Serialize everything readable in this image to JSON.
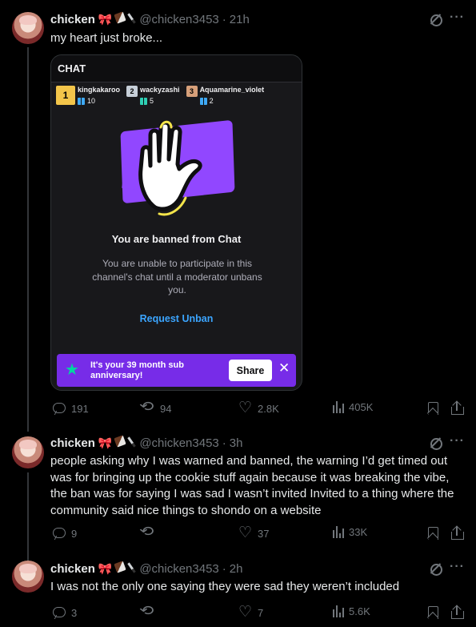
{
  "tweets": [
    {
      "name": "chicken",
      "handle": "@chicken3453",
      "time": "21h",
      "text": "my heart just broke...",
      "stats": {
        "replies": "191",
        "reposts": "94",
        "likes": "2.8K",
        "views": "405K"
      }
    },
    {
      "name": "chicken",
      "handle": "@chicken3453",
      "time": "3h",
      "text": "people asking why I was warned and banned, the warning I’d get timed out was for bringing up the cookie stuff again because it was breaking the vibe, the ban was for saying I was sad I wasn’t invited Invited to a thing where the community said nice things to shondo on a website",
      "stats": {
        "replies": "9",
        "reposts": "",
        "likes": "37",
        "views": "33K"
      }
    },
    {
      "name": "chicken",
      "handle": "@chicken3453",
      "time": "2h",
      "text": "I was not the only one saying they were sad they weren’t included",
      "stats": {
        "replies": "3",
        "reposts": "",
        "likes": "7",
        "views": "5.6K"
      }
    }
  ],
  "separator": "·",
  "more_glyph": "···",
  "media": {
    "header": "CHAT",
    "leaders": [
      {
        "rank": "1",
        "name": "kingkakaroo",
        "count": "10"
      },
      {
        "rank": "2",
        "name": "wackyzashi",
        "count": "5"
      },
      {
        "rank": "3",
        "name": "Aquamarine_violet",
        "count": "2"
      }
    ],
    "banned_title": "You are banned from Chat",
    "banned_body": "You are unable to participate in this channel's chat until a moderator unbans you.",
    "request_unban": "Request Unban",
    "anniversary": "It's your 39 month sub anniversary!",
    "share": "Share",
    "close": "✕"
  },
  "colors": {
    "accent_purple": "#9147ff",
    "banner_purple": "#772ce8",
    "link_blue": "#3ba5ff"
  }
}
